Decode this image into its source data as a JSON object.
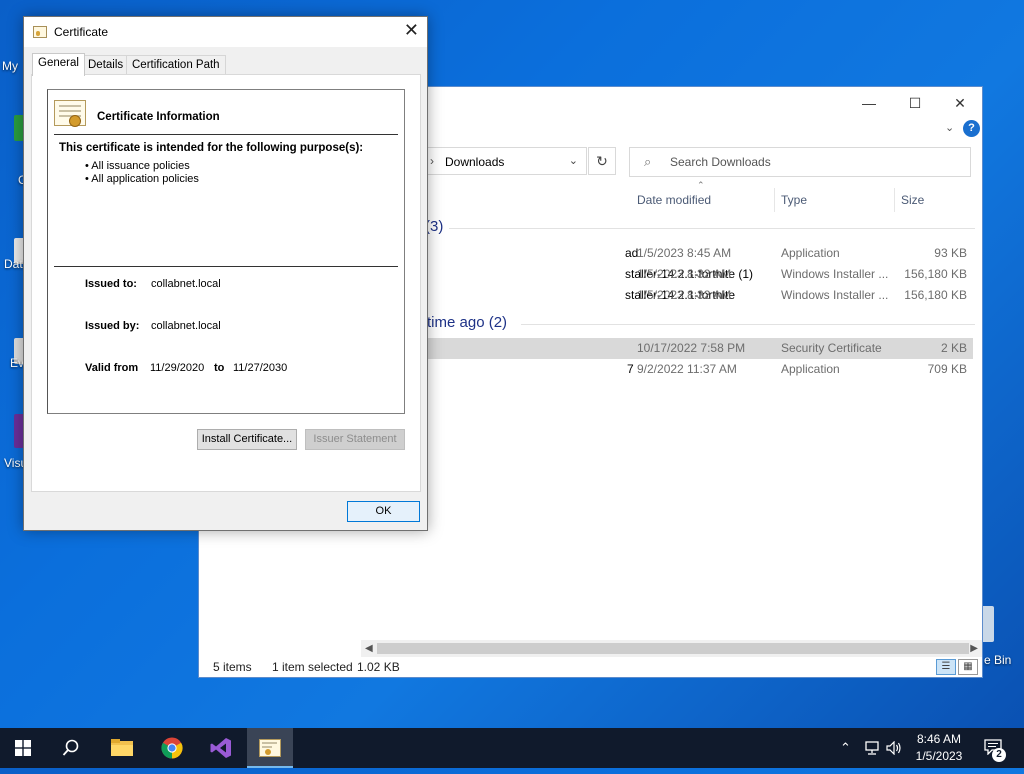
{
  "desktop": {
    "icons": [
      {
        "label": "My"
      },
      {
        "label": "C"
      },
      {
        "label": "Data"
      },
      {
        "label": "Ev"
      },
      {
        "label": "Visu"
      },
      {
        "label": "e Bin"
      }
    ]
  },
  "explorer": {
    "controls": {
      "minimize": "—",
      "maximize": "☐",
      "close": "✕"
    },
    "address": {
      "separator": "›",
      "crumb": "Downloads"
    },
    "search_placeholder": "Search Downloads",
    "columns": [
      "Date modified",
      "Type",
      "Size"
    ],
    "groups": [
      {
        "label": "(3)"
      },
      {
        "label": "time ago (2)"
      }
    ],
    "files": [
      {
        "name": "ad",
        "date": "1/5/2023 8:45 AM",
        "type": "Application",
        "size": "93 KB"
      },
      {
        "name": "staller-14.2.1-fortnite (1)",
        "date": "1/5/2023 8:32 AM",
        "type": "Windows Installer ...",
        "size": "156,180 KB"
      },
      {
        "name": "staller-14.2.1-fortnite",
        "date": "1/5/2023 8:32 AM",
        "type": "Windows Installer ...",
        "size": "156,180 KB"
      },
      {
        "name": "",
        "date": "10/17/2022 7:58 PM",
        "type": "Security Certificate",
        "size": "2 KB"
      },
      {
        "name": "7",
        "date": "9/2/2022 11:37 AM",
        "type": "Application",
        "size": "709 KB"
      }
    ],
    "status": {
      "items": "5 items",
      "selected": "1 item selected",
      "size": "1.02 KB"
    }
  },
  "dialog": {
    "title": "Certificate",
    "close": "✕",
    "tabs": [
      "General",
      "Details",
      "Certification Path"
    ],
    "info_title": "Certificate Information",
    "purpose_heading": "This certificate is intended for the following purpose(s):",
    "purposes": [
      "• All issuance policies",
      "• All application policies"
    ],
    "issued_to_label": "Issued to:",
    "issued_to": "collabnet.local",
    "issued_by_label": "Issued by:",
    "issued_by": "collabnet.local",
    "valid_from_label": "Valid from",
    "valid_from": "11/29/2020",
    "to_label": "to",
    "valid_to": "11/27/2030",
    "install_button": "Install Certificate...",
    "issuer_button": "Issuer Statement",
    "ok_button": "OK"
  },
  "taskbar": {
    "clock_time": "8:46 AM",
    "clock_date": "1/5/2023",
    "notification_count": "2"
  }
}
